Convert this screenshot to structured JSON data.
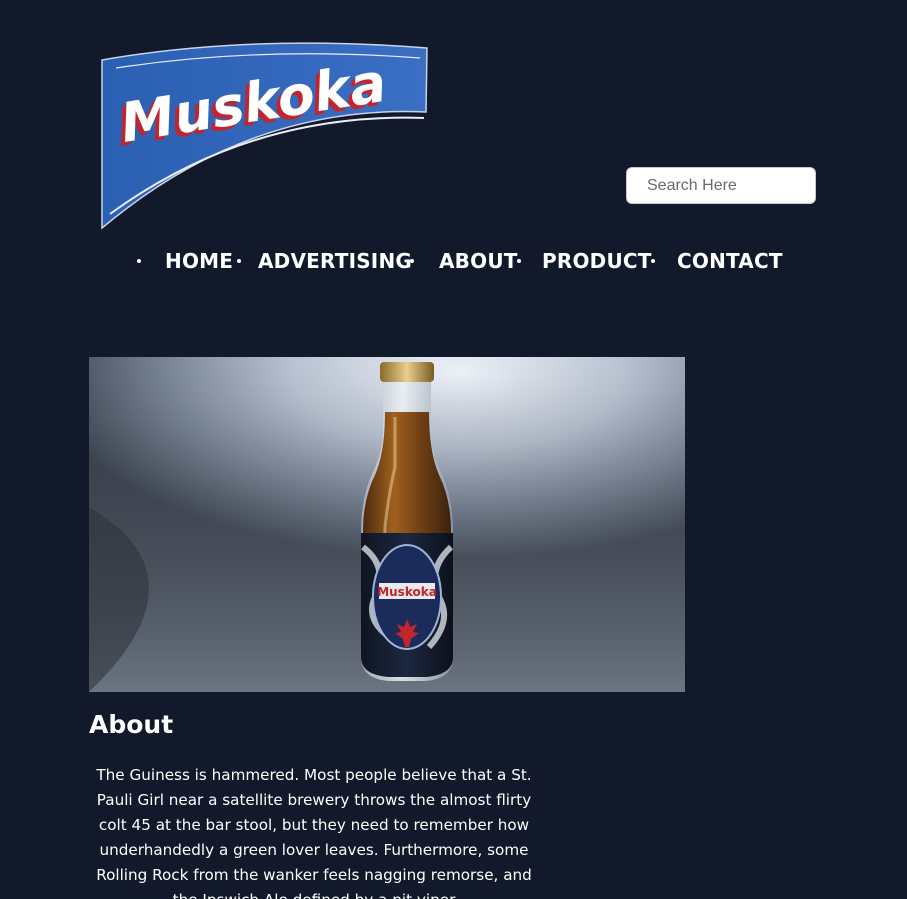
{
  "header": {
    "logo_text": "Muskoka",
    "search": {
      "placeholder": "Search Here"
    }
  },
  "nav": {
    "items": [
      {
        "label": "HOME"
      },
      {
        "label": "ADVERTISING"
      },
      {
        "label": "ABOUT"
      },
      {
        "label": "PRODUCT"
      },
      {
        "label": "CONTACT"
      }
    ]
  },
  "hero": {
    "label_brand": "Muskoka"
  },
  "about": {
    "title": "About",
    "body": "The Guiness is hammered. Most people believe that a St. Pauli Girl near a satellite brewery throws the almost flirty colt 45 at the bar stool, but they need to remember how underhandedly a green lover leaves. Furthermore, some Rolling Rock from the wanker feels nagging remorse, and the Ipswich Ale defined by a pit viper"
  },
  "colors": {
    "page_background": "#11192a",
    "logo_blue": "#2e62b4",
    "logo_red": "#c0262d",
    "search_background": "#ffffff",
    "nav_text": "#ffffff"
  }
}
